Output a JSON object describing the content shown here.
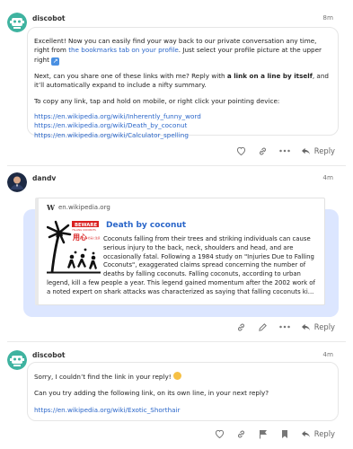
{
  "posts": [
    {
      "username": "discobot",
      "time": "8m",
      "paragraphs": {
        "p1_a": "Excellent! Now you can easily find your way back to our private conversation any time, right from ",
        "p1_link": "the bookmarks tab on your profile",
        "p1_b": ". Just select your profile picture at the upper right ",
        "p2_a": "Next, can you share one of these links with me? Reply with ",
        "p2_bold": "a link on a line by itself",
        "p2_b": ", and it’ll automatically expand to include a nifty summary.",
        "p3": "To copy any link, tap and hold on mobile, or right click your pointing device:"
      },
      "links": [
        "https://en.wikipedia.org/wiki/Inherently_funny_word",
        "https://en.wikipedia.org/wiki/Death_by_coconut",
        "https://en.wikipedia.org/wiki/Calculator_spelling"
      ],
      "reply_label": "Reply"
    },
    {
      "username": "dandv",
      "time": "4m",
      "onebox": {
        "host": "en.wikipedia.org",
        "title": "Death by coconut",
        "sign_text": "BEWARE",
        "sign_sub": "FALLING COCONUTS",
        "sign_jp": "ヤシの実に注意",
        "sign_kanji": "用心",
        "summary": "Coconuts falling from their trees and striking individuals can cause serious injury to the back, neck, shoulders and head, and are occasionally fatal. Following a 1984 study on \"Injuries Due to Falling Coconuts\", exaggerated claims spread concerning the number of deaths by falling coconuts. Falling coconuts, according to urban legend, kill a few people a year. This legend gained momentum after the 2002 work of a noted expert on shark attacks was characterized as saying that falling coconuts ki..."
      },
      "reply_label": "Reply"
    },
    {
      "username": "discobot",
      "time": "4m",
      "p1": "Sorry, I couldn’t find the link in your reply! ",
      "p2": "Can you try adding the following link, on its own line, in your next reply?",
      "link": "https://en.wikipedia.org/wiki/Exotic_Shorthair",
      "reply_label": "Reply"
    }
  ],
  "colors": {
    "link": "#2a66c9",
    "highlight": "#dce6ff",
    "discobot_avatar": "#3fb3a0"
  }
}
